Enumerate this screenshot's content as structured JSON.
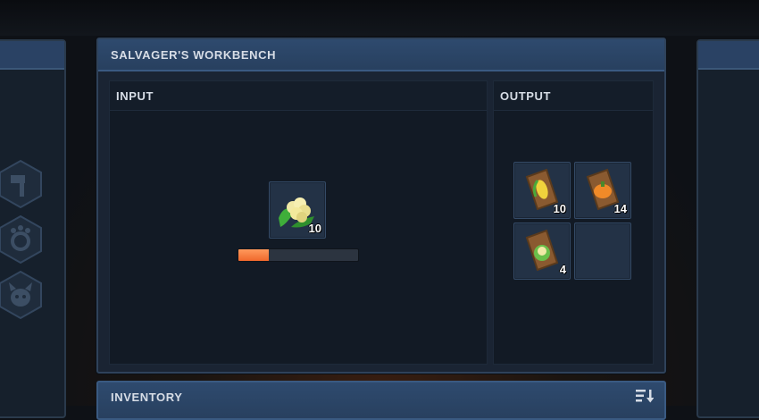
{
  "workbench": {
    "title": "SALVAGER'S WORKBENCH",
    "input": {
      "label": "INPUT",
      "slot": {
        "item": "cauliflower-icon",
        "count": "10"
      },
      "progress_percent": 25
    },
    "output": {
      "label": "OUTPUT",
      "slots": [
        {
          "item": "corn-seed-bag-icon",
          "count": "10"
        },
        {
          "item": "pumpkin-seed-bag-icon",
          "count": "14"
        },
        {
          "item": "cauliflower-seed-bag-icon",
          "count": "4"
        },
        {
          "item": "empty",
          "count": ""
        }
      ]
    }
  },
  "inventory": {
    "title": "INVENTORY",
    "sort_icon": "sort-icon"
  },
  "side_tabs": [
    "hammer-icon",
    "gear-paw-icon",
    "creature-icon"
  ],
  "colors": {
    "accent": "#2e4a6e",
    "progress": "#f0682c"
  }
}
